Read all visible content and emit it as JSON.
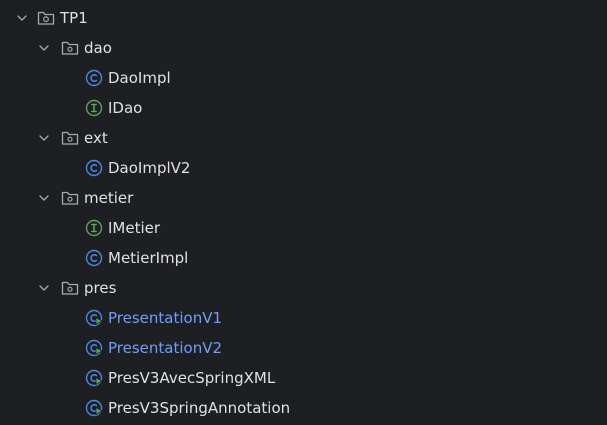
{
  "tree": {
    "root": {
      "label": "TP1"
    },
    "packages": [
      {
        "label": "dao",
        "children": [
          {
            "label": "DaoImpl",
            "kind": "class-icon"
          },
          {
            "label": "IDao",
            "kind": "interface-icon"
          }
        ]
      },
      {
        "label": "ext",
        "children": [
          {
            "label": "DaoImplV2",
            "kind": "class-icon"
          }
        ]
      },
      {
        "label": "metier",
        "children": [
          {
            "label": "IMetier",
            "kind": "interface-icon"
          },
          {
            "label": "MetierImpl",
            "kind": "class-icon"
          }
        ]
      },
      {
        "label": "pres",
        "children": [
          {
            "label": "PresentationV1",
            "kind": "main-class-icon",
            "modified": true
          },
          {
            "label": "PresentationV2",
            "kind": "main-class-icon",
            "modified": true
          },
          {
            "label": "PresV3AvecSpringXML",
            "kind": "main-class-icon"
          },
          {
            "label": "PresV3SpringAnnotation",
            "kind": "main-class-icon"
          }
        ]
      }
    ]
  },
  "colors": {
    "background": "#1e1f22",
    "text": "#dfe1e5",
    "modified_text": "#6e9fff",
    "class_icon": "#4d88e6",
    "interface_icon": "#5fa35f",
    "chevron": "#9aa0a6",
    "folder_icon": "#a8abb0"
  }
}
